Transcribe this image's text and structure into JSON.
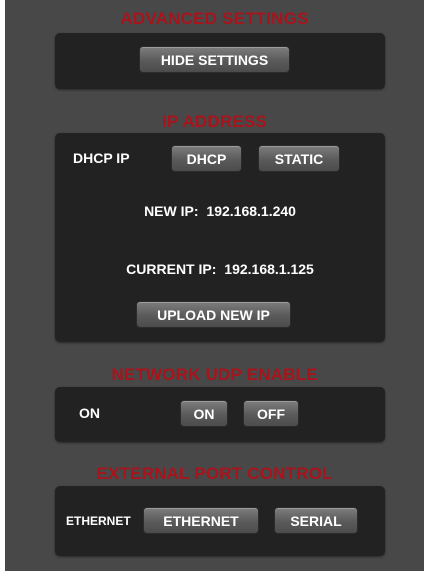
{
  "colors": {
    "background": "#484848",
    "box": "#222222",
    "title": "#a8141c",
    "button": "#5e5e5e",
    "text": "#ffffff"
  },
  "advanced": {
    "title": "ADVANCED SETTINGS",
    "hide_button": "HIDE SETTINGS"
  },
  "ip": {
    "title": "IP ADDRESS",
    "dhcp_label": "DHCP IP",
    "dhcp_button": "DHCP",
    "static_button": "STATIC",
    "new_ip_label": "NEW IP:",
    "new_ip_value": "192.168.1.240",
    "current_ip_label": "CURRENT IP:",
    "current_ip_value": "192.168.1.125",
    "upload_button": "UPLOAD NEW IP"
  },
  "udp": {
    "title": "NETWORK UDP ENABLE",
    "status": "ON",
    "on_button": "ON",
    "off_button": "OFF"
  },
  "port": {
    "title": "EXTERNAL PORT CONTROL",
    "status": "ETHERNET",
    "ethernet_button": "ETHERNET",
    "serial_button": "SERIAL"
  }
}
